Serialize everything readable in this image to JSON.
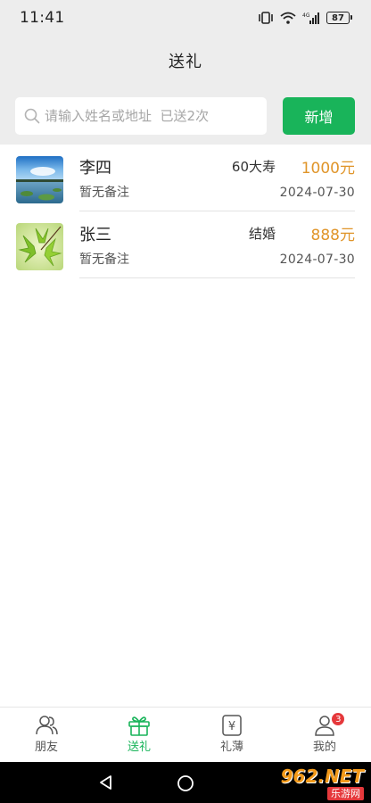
{
  "status_bar": {
    "time": "11:41",
    "battery": "87",
    "icons": [
      "vibrate-icon",
      "wifi-icon",
      "signal-4g-icon",
      "battery-icon"
    ]
  },
  "header": {
    "title": "送礼"
  },
  "search": {
    "placeholder": "请输入姓名或地址  已送2次",
    "add_label": "新增"
  },
  "colors": {
    "accent": "#19b45a",
    "amount": "#e0952a",
    "header_bg": "#ededed",
    "badge": "#e5383b"
  },
  "records": [
    {
      "name": "李四",
      "note": "暂无备注",
      "event": "60大寿",
      "amount": "1000元",
      "date": "2024-07-30",
      "avatar": "lake-landscape-photo"
    },
    {
      "name": "张三",
      "note": "暂无备注",
      "event": "结婚",
      "amount": "888元",
      "date": "2024-07-30",
      "avatar": "green-leaves-photo"
    }
  ],
  "tabs": [
    {
      "label": "朋友",
      "icon": "friends-icon",
      "active": false
    },
    {
      "label": "送礼",
      "icon": "gift-icon",
      "active": true
    },
    {
      "label": "礼薄",
      "icon": "ledger-yen-icon",
      "active": false
    },
    {
      "label": "我的",
      "icon": "profile-icon",
      "active": false,
      "badge": "3"
    }
  ],
  "watermark": {
    "main": "962.NET",
    "sub": "乐游网"
  }
}
